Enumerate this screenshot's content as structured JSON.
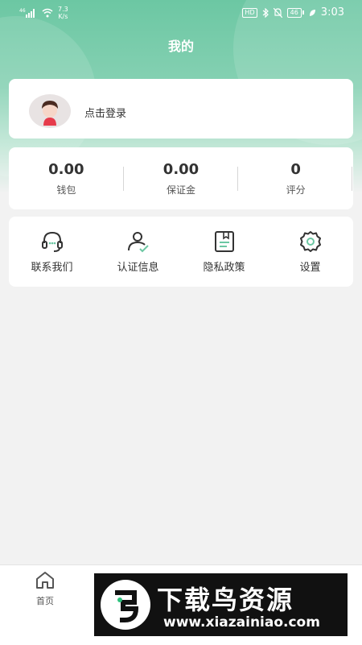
{
  "status_bar": {
    "network": "46",
    "speed_value": "7.3",
    "speed_unit": "K/s",
    "hd_badge": "HD",
    "battery": "46",
    "time": "3:03"
  },
  "header": {
    "title": "我的"
  },
  "profile": {
    "login_label": "点击登录"
  },
  "stats": [
    {
      "value": "0.00",
      "label": "钱包"
    },
    {
      "value": "0.00",
      "label": "保证金"
    },
    {
      "value": "0",
      "label": "评分"
    }
  ],
  "menu": [
    {
      "label": "联系我们",
      "icon": "headset-icon"
    },
    {
      "label": "认证信息",
      "icon": "user-verified-icon"
    },
    {
      "label": "隐私政策",
      "icon": "document-icon"
    },
    {
      "label": "设置",
      "icon": "gear-icon"
    }
  ],
  "tabbar": {
    "home_label": "首页"
  },
  "watermark": {
    "title": "下载鸟资源",
    "url": "www.xiazainiao.com"
  },
  "colors": {
    "accent": "#6cc7a3",
    "background": "#f2f2f2",
    "text": "#333333"
  }
}
